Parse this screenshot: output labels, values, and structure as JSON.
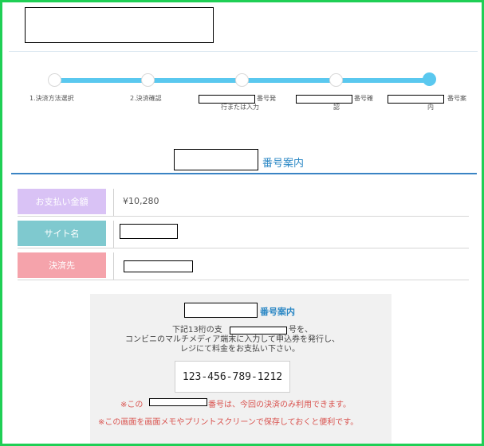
{
  "steps": [
    {
      "label": "1.決済方法選択"
    },
    {
      "label": "2.決済確認"
    },
    {
      "label_tail": "番号発",
      "label_line2": "行または入力"
    },
    {
      "label_tail": "番号確",
      "label_line2": "認"
    },
    {
      "label_tail": "番号案",
      "label_line2": "内"
    }
  ],
  "page_title_tail": "番号案内",
  "info": [
    {
      "label": "お支払い金額",
      "value": "¥10,280",
      "color": "#d9c2f5"
    },
    {
      "label": "サイト名",
      "value": "",
      "color": "#7fc9cf"
    },
    {
      "label": "決済先",
      "value": "",
      "color": "#f5a3ab"
    }
  ],
  "guide": {
    "title_tail": "番号案内",
    "line1_head": "下記13桁の支",
    "line1_tail": "号を、",
    "line2": "コンビニのマルチメディア端末に入力して申込券を発行し、",
    "line3": "レジにて料金をお支払い下さい。",
    "payment_number": "123-456-789-1212",
    "note1_head": "※この",
    "note1_tail": "番号は、今回の決済のみ利用できます。",
    "note2": "※この画面を画面メモやプリントスクリーンで保存しておくと便利です。"
  },
  "colors": {
    "accent": "#2c88c5",
    "progress": "#5ac8ef",
    "border": "#1fcf55"
  }
}
